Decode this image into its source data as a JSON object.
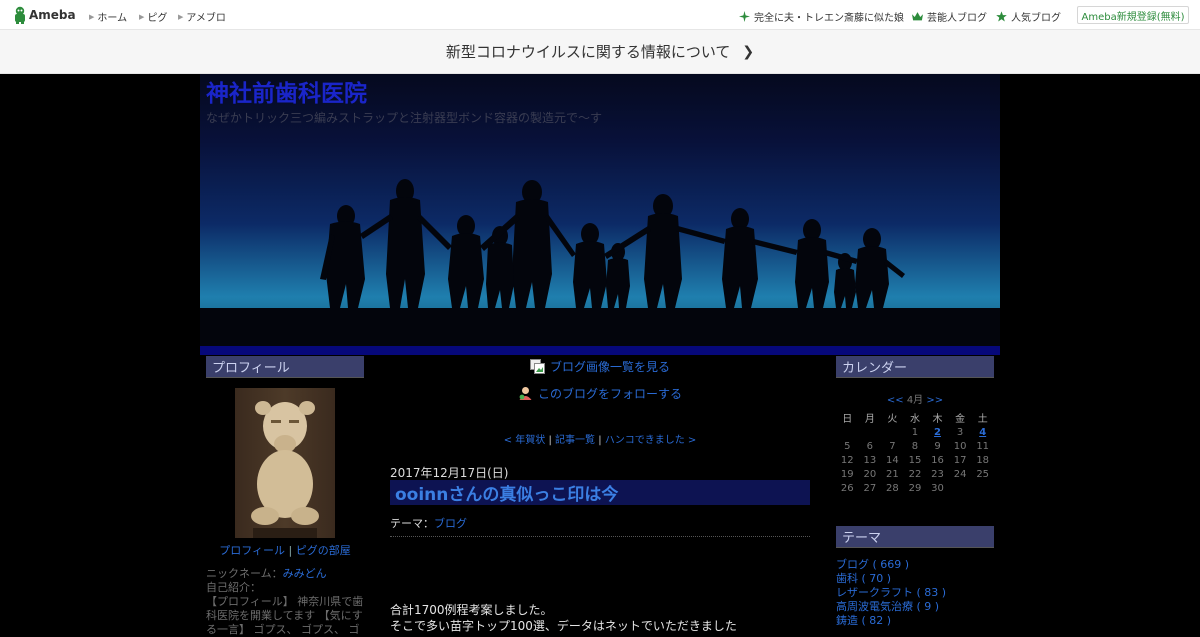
{
  "header": {
    "logo_text": "Ameba",
    "nav": [
      "ホーム",
      "ピグ",
      "アメブロ"
    ],
    "right_links": [
      "完全に夫・トレエン斎藤に似た娘",
      "芸能人ブログ",
      "人気ブログ"
    ],
    "register_button": "Ameba新規登録(無料)"
  },
  "notice": {
    "text": "新型コロナウイルスに関する情報について"
  },
  "blog": {
    "title": "神社前歯科医院",
    "description": "なぜかトリック三つ編みストラップと注射器型ボンド容器の製造元で～す"
  },
  "profile": {
    "heading": "プロフィール",
    "links": [
      "プロフィール",
      "ピグの部屋"
    ],
    "nickname_label": "ニックネーム：",
    "nickname": "みみどん",
    "intro_label": "自己紹介：",
    "intro_text": "【プロフィール】 神奈川県で歯科医院を開業してます 【気にする一言】 ゴプス、 ゴプス、 ゴ"
  },
  "center": {
    "image_list_link": "ブログ画像一覧を見る",
    "follow_link": "このブログをフォローする",
    "prev_link": "< 年賀状",
    "list_link": "記事一覧",
    "next_link": "ハンコできました >",
    "post": {
      "date": "2017年12月17日(日)",
      "title": "ooinnさんの真似っこ印は今",
      "theme_label": "テーマ：",
      "theme": "ブログ",
      "body_lines": [
        "合計1700例程考案しました。",
        "そこで多い苗字トップ100選、データはネットでいただきました"
      ]
    }
  },
  "calendar": {
    "heading": "カレンダー",
    "prev": "<<",
    "month": "4月",
    "next": ">>",
    "weekdays": [
      "日",
      "月",
      "火",
      "水",
      "木",
      "金",
      "土"
    ],
    "weeks": [
      [
        "",
        "",
        "",
        "1",
        "2",
        "3",
        "4"
      ],
      [
        "5",
        "6",
        "7",
        "8",
        "9",
        "10",
        "11"
      ],
      [
        "12",
        "13",
        "14",
        "15",
        "16",
        "17",
        "18"
      ],
      [
        "19",
        "20",
        "21",
        "22",
        "23",
        "24",
        "25"
      ],
      [
        "26",
        "27",
        "28",
        "29",
        "30",
        "",
        ""
      ]
    ],
    "linked_days": [
      "2",
      "4"
    ]
  },
  "themes": {
    "heading": "テーマ",
    "items": [
      "ブログ ( 669 )",
      "歯科 ( 70 )",
      "レザークラフト ( 83 )",
      "高周波電気治療 ( 9 )",
      "鋳造 ( 82 )"
    ]
  },
  "colors": {
    "accent_link": "#2a6bd5",
    "section_head_bg": "#3a3f6b",
    "brand_green": "#2d8c3c"
  }
}
